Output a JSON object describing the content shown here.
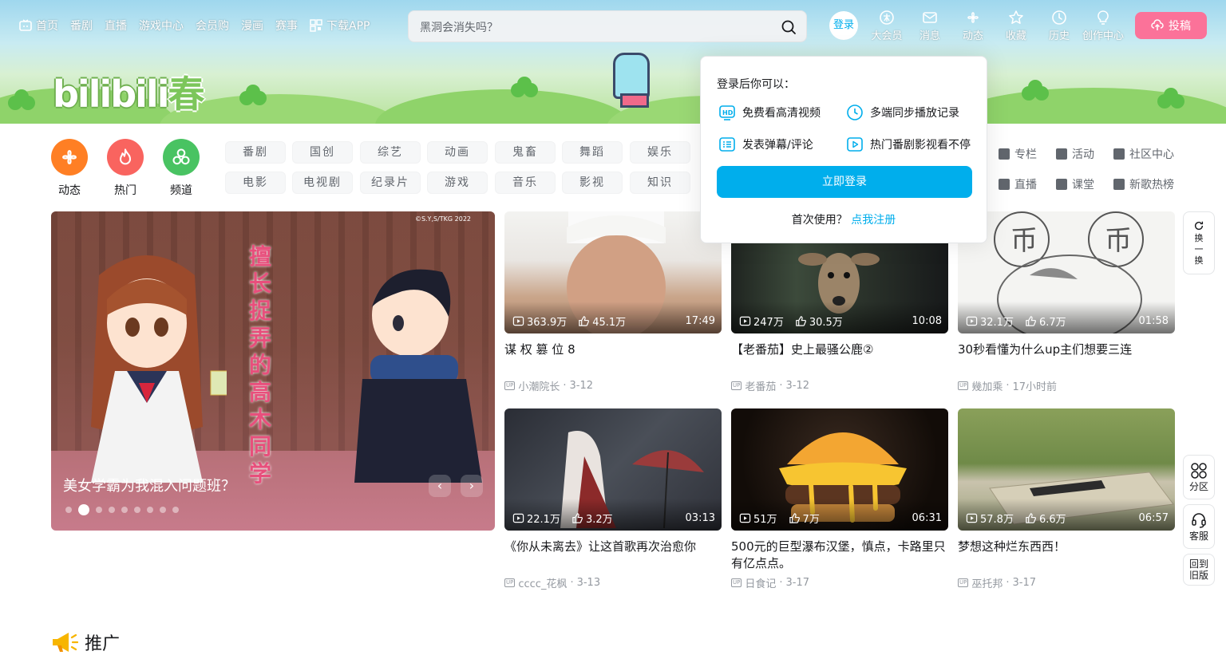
{
  "nav": {
    "left": [
      {
        "label": "首页",
        "icon": "tv-icon"
      },
      {
        "label": "番剧"
      },
      {
        "label": "直播"
      },
      {
        "label": "游戏中心"
      },
      {
        "label": "会员购"
      },
      {
        "label": "漫画"
      },
      {
        "label": "赛事"
      },
      {
        "label": "下载APP",
        "icon": "qr-icon"
      }
    ],
    "search_placeholder": "黑洞会消失吗？",
    "login_label": "登录",
    "right": [
      {
        "label": "大会员",
        "icon": "vip-icon"
      },
      {
        "label": "消息",
        "icon": "mail-icon"
      },
      {
        "label": "动态",
        "icon": "pinwheel-icon"
      },
      {
        "label": "收藏",
        "icon": "star-icon"
      },
      {
        "label": "历史",
        "icon": "clock-icon"
      },
      {
        "label": "创作中心",
        "icon": "bulb-icon"
      }
    ],
    "upload_label": "投稿"
  },
  "channels": {
    "main": [
      {
        "label": "动态",
        "color": "#ff7f24"
      },
      {
        "label": "热门",
        "color": "#f9645f"
      },
      {
        "label": "频道",
        "color": "#49c362"
      }
    ],
    "row1": [
      "番剧",
      "国创",
      "综艺",
      "动画",
      "鬼畜",
      "舞蹈",
      "娱乐"
    ],
    "row2": [
      "电影",
      "电视剧",
      "纪录片",
      "游戏",
      "音乐",
      "影视",
      "知识"
    ],
    "side1": [
      "专栏",
      "活动",
      "社区中心"
    ],
    "side2": [
      "直播",
      "课堂",
      "新歌热榜"
    ]
  },
  "carousel": {
    "caption": "美女学霸为我混入问题班？",
    "vertical_title": "擅长捉弄的高木同学",
    "copyright": "©S.Y,S/TKG 2022",
    "dot_count": 9,
    "active_dot": 1
  },
  "videos": [
    {
      "views": "363.9万",
      "likes": "45.1万",
      "duration": "17:49",
      "title": "谋 权 篡 位 8",
      "author": "小潮院长",
      "date": "3-12"
    },
    {
      "views": "247万",
      "likes": "30.5万",
      "duration": "10:08",
      "title": "【老番茄】史上最骚公鹿②",
      "author": "老番茄",
      "date": "3-12"
    },
    {
      "views": "32.1万",
      "likes": "6.7万",
      "duration": "01:58",
      "title": "30秒看懂为什么up主们想要三连",
      "author": "幾加乘",
      "date": "17小时前"
    },
    {
      "views": "22.1万",
      "likes": "3.2万",
      "duration": "03:13",
      "title": "《你从未离去》让这首歌再次治愈你",
      "author": "cccc_花枫",
      "date": "3-13"
    },
    {
      "views": "51万",
      "likes": "7万",
      "duration": "06:31",
      "title": "500元的巨型瀑布汉堡，慎点，卡路里只有亿点点。",
      "author": "日食记",
      "date": "3-17"
    },
    {
      "views": "57.8万",
      "likes": "6.6万",
      "duration": "06:57",
      "title": "梦想这种烂东西西！",
      "author": "巫托邦",
      "date": "3-17"
    }
  ],
  "popup": {
    "title": "登录后你可以：",
    "items": [
      "免费看高清视频",
      "多端同步播放记录",
      "发表弹幕/评论",
      "热门番剧影视看不停"
    ],
    "button": "立即登录",
    "register_prefix": "首次使用？",
    "register_link": "点我注册"
  },
  "tools": {
    "refresh": "换一换",
    "category": "分区",
    "service": "客服",
    "old_version": "回到旧版"
  },
  "promo": {
    "title": "推广"
  },
  "colors": {
    "accent": "#00aeec",
    "pink": "#fb7299"
  }
}
